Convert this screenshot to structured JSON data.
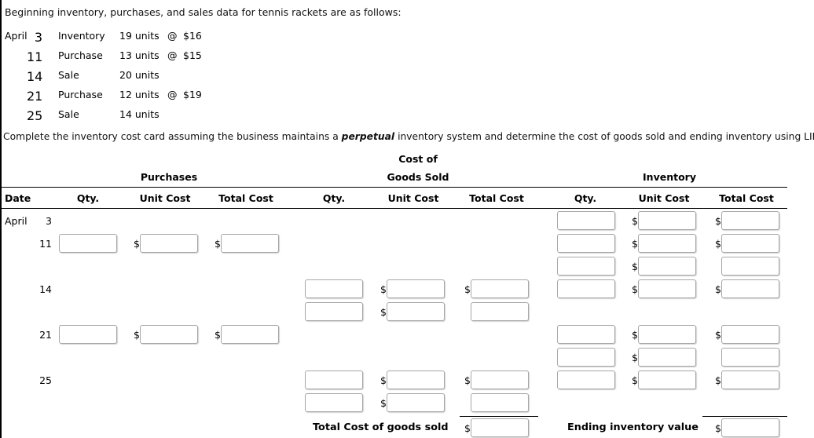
{
  "prompt": {
    "intro": "Beginning inventory, purchases, and sales data for tennis rackets are as follows:",
    "instruction_pre": "Complete the inventory cost card assuming the business maintains a ",
    "instruction_em": "perpetual",
    "instruction_post": " inventory system and determine the cost of goods sold and ending inventory using LIFO."
  },
  "facts": {
    "month": "April",
    "rows": [
      {
        "day": "3",
        "kind": "Inventory",
        "units": "19 units",
        "at": "@",
        "price": "$16"
      },
      {
        "day": "11",
        "kind": "Purchase",
        "units": "13 units",
        "at": "@",
        "price": "$15"
      },
      {
        "day": "14",
        "kind": "Sale",
        "units": "20 units",
        "at": "",
        "price": ""
      },
      {
        "day": "21",
        "kind": "Purchase",
        "units": "12 units",
        "at": "@",
        "price": "$19"
      },
      {
        "day": "25",
        "kind": "Sale",
        "units": "14 units",
        "at": "",
        "price": ""
      }
    ]
  },
  "table": {
    "group_headers": {
      "purchases": "Purchases",
      "cogs_line1": "Cost of",
      "cogs_line2": "Goods Sold",
      "inventory": "Inventory"
    },
    "columns": {
      "date": "Date",
      "purch_qty": "Qty.",
      "purch_unit": "Unit Cost",
      "purch_total": "Total Cost",
      "cogs_qty": "Qty.",
      "cogs_unit": "Unit Cost",
      "cogs_total": "Total Cost",
      "inv_qty": "Qty.",
      "inv_unit": "Unit Cost",
      "inv_total": "Total Cost"
    },
    "date_cells": {
      "month": "April",
      "d3": "3",
      "d11": "11",
      "d14": "14",
      "d21": "21",
      "d25": "25"
    },
    "dollar_sign": "$",
    "totals": {
      "cogs_label": "Total Cost of goods sold",
      "inventory_label": "Ending inventory value"
    },
    "field_values": {
      "p11_qty": "",
      "p11_unit": "",
      "p11_total": "",
      "p21_qty": "",
      "p21_unit": "",
      "p21_total": "",
      "c14_qty_a": "",
      "c14_unit_a": "",
      "c14_total_a": "",
      "c14_qty_b": "",
      "c14_unit_b": "",
      "c14_total_b": "",
      "c25_qty_a": "",
      "c25_unit_a": "",
      "c25_total_a": "",
      "c25_qty_b": "",
      "c25_unit_b": "",
      "c25_total_b": "",
      "i3_qty": "",
      "i3_unit": "",
      "i3_total": "",
      "i11_qty_a": "",
      "i11_unit_a": "",
      "i11_total_a": "",
      "i11_qty_b": "",
      "i11_unit_b": "",
      "i11_total_b": "",
      "i14_qty": "",
      "i14_unit": "",
      "i14_total": "",
      "i21_qty_a": "",
      "i21_unit_a": "",
      "i21_total_a": "",
      "i21_qty_b": "",
      "i21_unit_b": "",
      "i21_total_b": "",
      "i25_qty": "",
      "i25_unit": "",
      "i25_total": "",
      "total_cogs": "",
      "ending_inventory": ""
    }
  }
}
